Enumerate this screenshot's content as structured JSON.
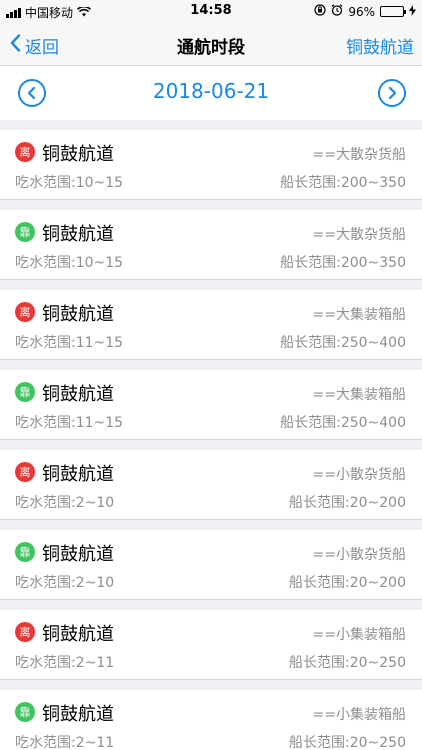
{
  "status_bar": {
    "carrier": "中国移动",
    "time": "14:58",
    "battery": "96%"
  },
  "nav": {
    "back_label": "返回",
    "title": "通航时段",
    "right_label": "铜鼓航道"
  },
  "date_bar": {
    "date": "2018-06-21"
  },
  "colors": {
    "accent": "#1c88e0",
    "leave": "#e53935",
    "dock": "#43c463"
  },
  "items": [
    {
      "badge": "离",
      "badge_kind": "leave",
      "name": "铜鼓航道",
      "type": "==大散杂货船",
      "draft": "吃水范围:10~15",
      "length": "船长范围:200~350"
    },
    {
      "badge": "靠",
      "badge_kind": "dock",
      "name": "铜鼓航道",
      "type": "==大散杂货船",
      "draft": "吃水范围:10~15",
      "length": "船长范围:200~350"
    },
    {
      "badge": "离",
      "badge_kind": "leave",
      "name": "铜鼓航道",
      "type": "==大集装箱船",
      "draft": "吃水范围:11~15",
      "length": "船长范围:250~400"
    },
    {
      "badge": "靠",
      "badge_kind": "dock",
      "name": "铜鼓航道",
      "type": "==大集装箱船",
      "draft": "吃水范围:11~15",
      "length": "船长范围:250~400"
    },
    {
      "badge": "离",
      "badge_kind": "leave",
      "name": "铜鼓航道",
      "type": "==小散杂货船",
      "draft": "吃水范围:2~10",
      "length": "船长范围:20~200"
    },
    {
      "badge": "靠",
      "badge_kind": "dock",
      "name": "铜鼓航道",
      "type": "==小散杂货船",
      "draft": "吃水范围:2~10",
      "length": "船长范围:20~200"
    },
    {
      "badge": "离",
      "badge_kind": "leave",
      "name": "铜鼓航道",
      "type": "==小集装箱船",
      "draft": "吃水范围:2~11",
      "length": "船长范围:20~250"
    },
    {
      "badge": "靠",
      "badge_kind": "dock",
      "name": "铜鼓航道",
      "type": "==小集装箱船",
      "draft": "吃水范围:2~11",
      "length": "船长范围:20~250"
    }
  ]
}
